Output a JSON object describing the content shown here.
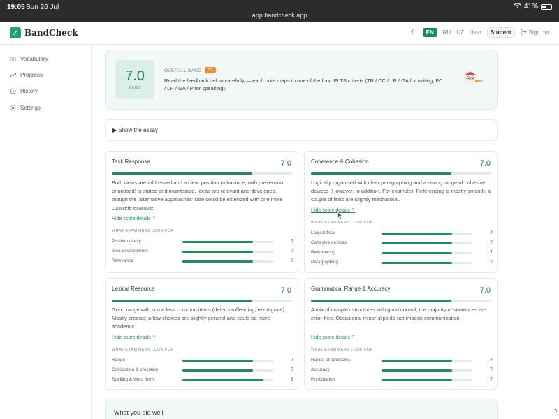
{
  "status": {
    "time": "19:05",
    "date": "Sun 26 Jul",
    "url": "app.bandcheck.app",
    "battery": "41%"
  },
  "header": {
    "brand": "BandCheck",
    "languages": [
      "EN",
      "RU",
      "UZ"
    ],
    "user_label": "User",
    "role": "Student",
    "sign_out": "Sign out"
  },
  "sidebar": {
    "items": [
      {
        "label": "Vocabulary",
        "icon": "book-icon"
      },
      {
        "label": "Progress",
        "icon": "trend-icon"
      },
      {
        "label": "History",
        "icon": "history-icon"
      },
      {
        "label": "Settings",
        "icon": "gear-icon"
      }
    ]
  },
  "overall": {
    "score": "7.0",
    "caption": "BAND",
    "label": "OVERALL BAND",
    "cefr": "C1",
    "description": "Read the feedback below carefully — each note maps to one of the four IELTS criteria (TR / CC / LR / GA for writing, FC / LR / GA / P for speaking)."
  },
  "essay_toggle": "▶ Show the essay",
  "cards": [
    {
      "title": "Task Response",
      "score": "7.0",
      "fill": 0.78,
      "text": "Both views are addressed and a clear position (a balance, with prevention prioritised) is stated and maintained. Ideas are relevant and developed, though the 'alternative approaches' side could be extended with one more concrete example.",
      "link": "Hide score details ⌃",
      "criteria_head": "WHAT EXAMINERS LOOK FOR",
      "criteria": [
        {
          "label": "Position clarity",
          "value": "7",
          "fill": 0.78
        },
        {
          "label": "Idea development",
          "value": "7",
          "fill": 0.78
        },
        {
          "label": "Relevance",
          "value": "7",
          "fill": 0.78
        }
      ]
    },
    {
      "title": "Coherence & Cohesion",
      "score": "7.0",
      "fill": 0.78,
      "text": "Logically organised with clear paragraphing and a strong range of cohesive devices (However, In addition, For example). Referencing is mostly smooth; a couple of links are slightly mechanical.",
      "link": "Hide score details ⌃",
      "criteria_head": "WHAT EXAMINERS LOOK FOR",
      "criteria": [
        {
          "label": "Logical flow",
          "value": "7",
          "fill": 0.78
        },
        {
          "label": "Cohesive devices",
          "value": "7",
          "fill": 0.78
        },
        {
          "label": "Referencing",
          "value": "7",
          "fill": 0.78
        },
        {
          "label": "Paragraphing",
          "value": "7",
          "fill": 0.78
        }
      ]
    },
    {
      "title": "Lexical Resource",
      "score": "7.0",
      "fill": 0.78,
      "text": "Good range with some less common items (deter, reoffending, reintegrate). Mostly precise; a few choices are slightly general and could be more academic.",
      "link": "Hide score details ⌃",
      "criteria_head": "WHAT EXAMINERS LOOK FOR",
      "criteria": [
        {
          "label": "Range",
          "value": "7",
          "fill": 0.78
        },
        {
          "label": "Collocation & precision",
          "value": "7",
          "fill": 0.78
        },
        {
          "label": "Spelling & word form",
          "value": "8",
          "fill": 0.89
        }
      ]
    },
    {
      "title": "Grammatical Range & Accuracy",
      "score": "7.0",
      "fill": 0.78,
      "text": "A mix of complex structures with good control; the majority of sentences are error-free. Occasional minor slips do not impede communication.",
      "link": "Hide score details ⌃",
      "criteria_head": "WHAT EXAMINERS LOOK FOR",
      "criteria": [
        {
          "label": "Range of structures",
          "value": "7",
          "fill": 0.78
        },
        {
          "label": "Accuracy",
          "value": "7",
          "fill": 0.78
        },
        {
          "label": "Punctuation",
          "value": "7",
          "fill": 0.78
        }
      ]
    }
  ],
  "well_title": "What you did well",
  "colors": {
    "accent": "#1f8c5b",
    "badge": "#ef8f2b",
    "panel": "#f1f8f5"
  }
}
